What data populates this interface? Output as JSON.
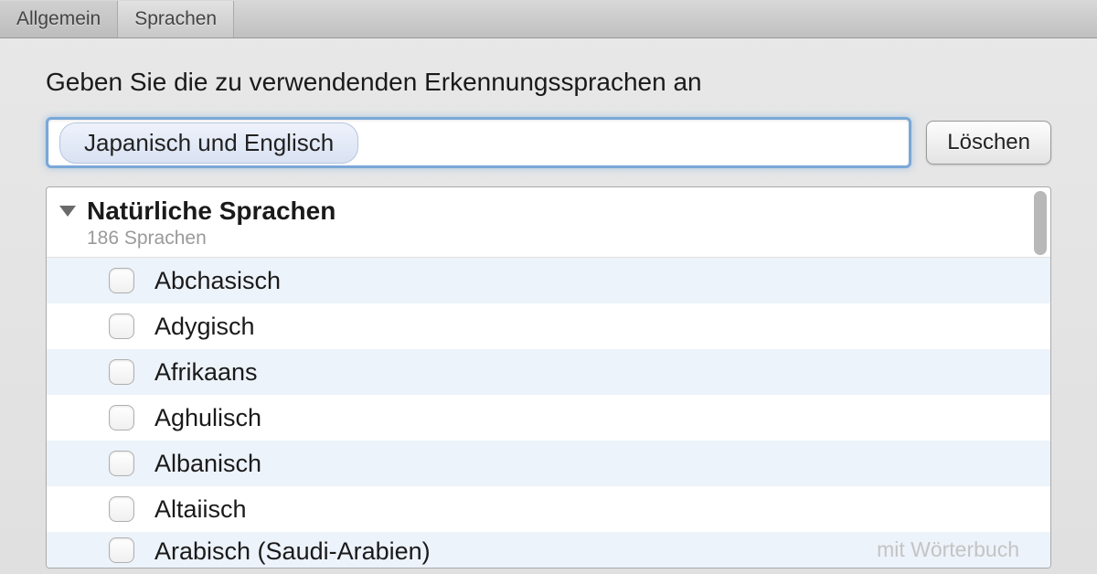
{
  "tabs": [
    {
      "label": "Allgemein",
      "active": false
    },
    {
      "label": "Sprachen",
      "active": true
    }
  ],
  "instruction": "Geben Sie die zu verwendenden Erkennungssprachen an",
  "search": {
    "token": "Japanisch und Englisch"
  },
  "clear_label": "Löschen",
  "group": {
    "title": "Natürliche Sprachen",
    "subtitle": "186 Sprachen"
  },
  "languages": [
    {
      "name": "Abchasisch",
      "checked": false,
      "hint": ""
    },
    {
      "name": "Adygisch",
      "checked": false,
      "hint": ""
    },
    {
      "name": "Afrikaans",
      "checked": false,
      "hint": ""
    },
    {
      "name": "Aghulisch",
      "checked": false,
      "hint": ""
    },
    {
      "name": "Albanisch",
      "checked": false,
      "hint": ""
    },
    {
      "name": "Altaiisch",
      "checked": false,
      "hint": ""
    },
    {
      "name": "Arabisch (Saudi-Arabien)",
      "checked": false,
      "hint": "mit Wörterbuch"
    }
  ]
}
